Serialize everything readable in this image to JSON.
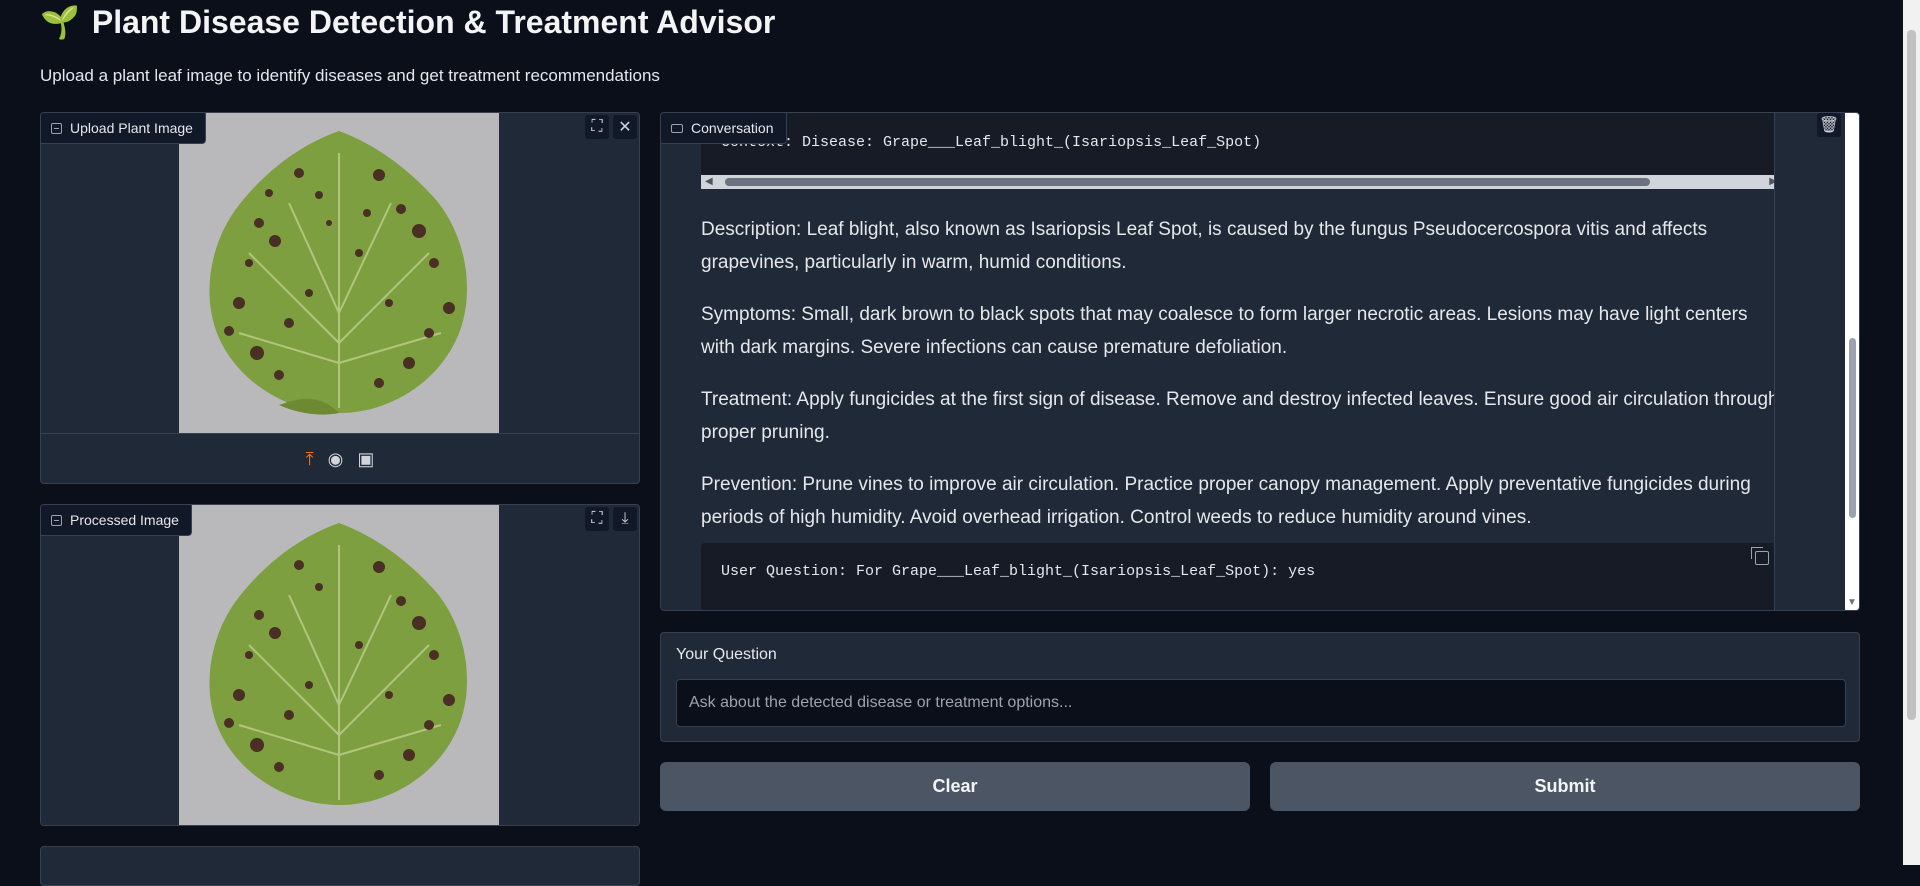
{
  "app": {
    "icon": "sprout-icon",
    "title": "Plant Disease Detection & Treatment Advisor",
    "subtitle": "Upload a plant leaf image to identify diseases and get treatment recommendations"
  },
  "upload_panel": {
    "label": "Upload Plant Image",
    "tools": [
      "fullscreen-icon",
      "close-icon"
    ],
    "sources": [
      "upload-icon",
      "webcam-icon",
      "clipboard-icon"
    ]
  },
  "processed_panel": {
    "label": "Processed Image",
    "tools": [
      "fullscreen-icon",
      "download-icon"
    ]
  },
  "conversation": {
    "label": "Conversation",
    "context_line": "Context: Disease: Grape___Leaf_blight_(Isariopsis_Leaf_Spot)",
    "description": "Description: Leaf blight, also known as Isariopsis Leaf Spot, is caused by the fungus Pseudocercospora vitis and affects grapevines, particularly in warm, humid conditions.",
    "symptoms": "Symptoms: Small, dark brown to black spots that may coalesce to form larger necrotic areas. Lesions may have light centers with dark margins. Severe infections can cause premature defoliation.",
    "treatment": "Treatment: Apply fungicides at the first sign of disease. Remove and destroy infected leaves. Ensure good air circulation through proper pruning.",
    "prevention": "Prevention: Prune vines to improve air circulation. Practice proper canopy management. Apply preventative fungicides during periods of high humidity. Avoid overhead irrigation. Control weeds to reduce humidity around vines.",
    "user_question_line": "User Question: For Grape___Leaf_blight_(Isariopsis_Leaf_Spot): yes"
  },
  "question": {
    "label": "Your Question",
    "placeholder": "Ask about the detected disease or treatment options...",
    "value": ""
  },
  "buttons": {
    "clear": "Clear",
    "submit": "Submit"
  }
}
